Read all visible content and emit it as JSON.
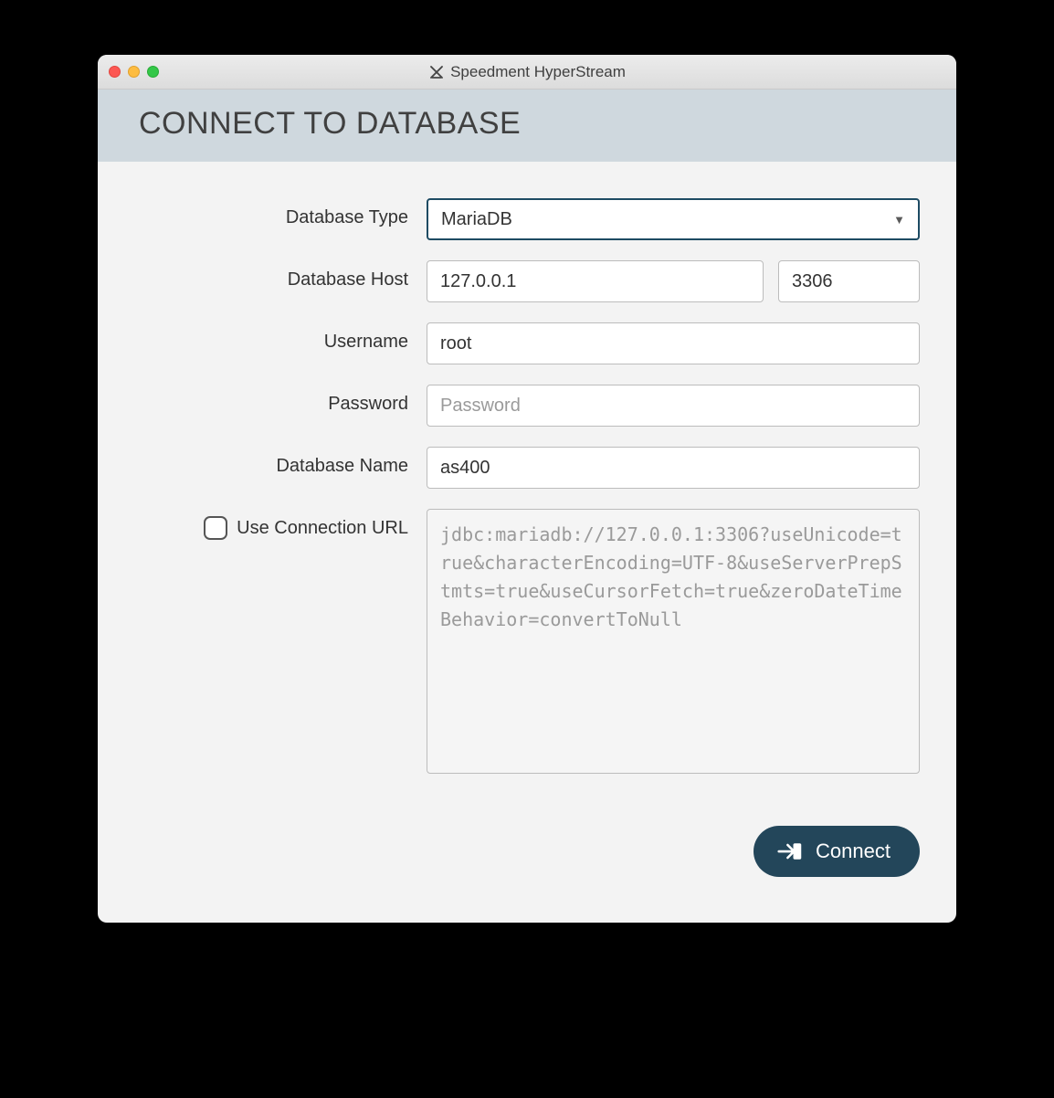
{
  "window": {
    "title": "Speedment HyperStream"
  },
  "header": {
    "title": "CONNECT TO DATABASE"
  },
  "form": {
    "database_type": {
      "label": "Database Type",
      "value": "MariaDB"
    },
    "database_host": {
      "label": "Database Host",
      "host": "127.0.0.1",
      "port": "3306"
    },
    "username": {
      "label": "Username",
      "value": "root"
    },
    "password": {
      "label": "Password",
      "placeholder": "Password",
      "value": ""
    },
    "database_name": {
      "label": "Database Name",
      "value": "as400"
    },
    "use_connection_url": {
      "label": "Use Connection URL",
      "checked": false
    },
    "connection_url": {
      "value": "jdbc:mariadb://127.0.0.1:3306?useUnicode=true&characterEncoding=UTF-8&useServerPrepStmts=true&useCursorFetch=true&zeroDateTimeBehavior=convertToNull"
    }
  },
  "actions": {
    "connect": "Connect"
  }
}
